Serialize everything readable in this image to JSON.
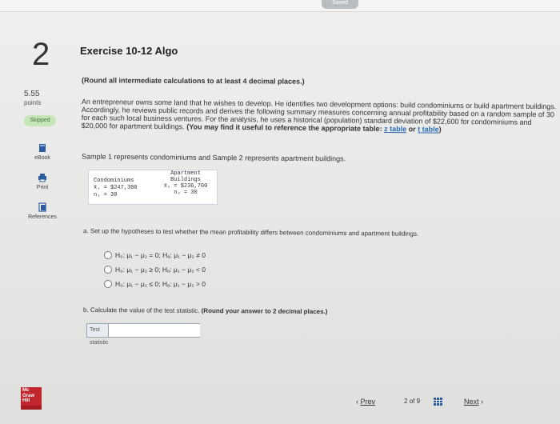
{
  "status": {
    "saved": "Saved"
  },
  "question": {
    "number": "2",
    "points_value": "5.55",
    "points_label": "points",
    "status_badge": "Skipped"
  },
  "sidebar": {
    "tools": [
      {
        "label": "eBook",
        "icon": "ebook-icon"
      },
      {
        "label": "Print",
        "icon": "print-icon"
      },
      {
        "label": "References",
        "icon": "references-icon"
      }
    ],
    "logo_lines": [
      "Mc",
      "Graw",
      "Hill",
      "Education"
    ]
  },
  "exercise": {
    "title": "Exercise 10-12 Algo",
    "instruction": "(Round all intermediate calculations to at least 4 decimal places.)",
    "paragraph_main": "An entrepreneur owns some land that he wishes to develop. He identifies two development options: build condominiums or build apartment buildings. Accordingly, he reviews public records and derives the following summary measures concerning annual profitability based on a random sample of 30 for each such local business ventures. For the analysis, he uses a historical (population) standard deviation of $22,600 for condominiums and $20,000 for apartment buildings.",
    "paragraph_bold": "(You may find it useful to reference the appropriate table:",
    "link_z": "z table",
    "or_text": "or",
    "link_t": "t table",
    "close_paren": ")",
    "sample_text": "Sample 1 represents condominiums and Sample 2 represents apartment buildings.",
    "table": {
      "col1_header": "Condominiums",
      "col1_mean": "x̄₁ = $247,300",
      "col1_n": "n₁ = 30",
      "col2_header_1": "Apartment",
      "col2_header_2": "Buildings",
      "col2_mean": "x̄₂ = $236,700",
      "col2_n": "n₂ = 30"
    },
    "part_a": "a. Set up the hypotheses to test whether the mean profitability differs between condominiums and apartment buildings.",
    "options": [
      "H₀: μ₁ − μ₂ = 0; Hₐ: μ₁ − μ₂ ≠ 0",
      "H₀: μ₁ − μ₂ ≥ 0; Hₐ: μ₁ − μ₂ < 0",
      "H₀: μ₁ − μ₂ ≤ 0; Hₐ: μ₁ − μ₂ > 0"
    ],
    "part_b": "b. Calculate the value of the test statistic.",
    "part_b_bold": "(Round your answer to 2 decimal places.)",
    "stat_label": "Test statistic",
    "stat_value": ""
  },
  "footer": {
    "prev": "Prev",
    "page_current": "2",
    "page_of": "of",
    "page_total": "9",
    "next": "Next"
  }
}
